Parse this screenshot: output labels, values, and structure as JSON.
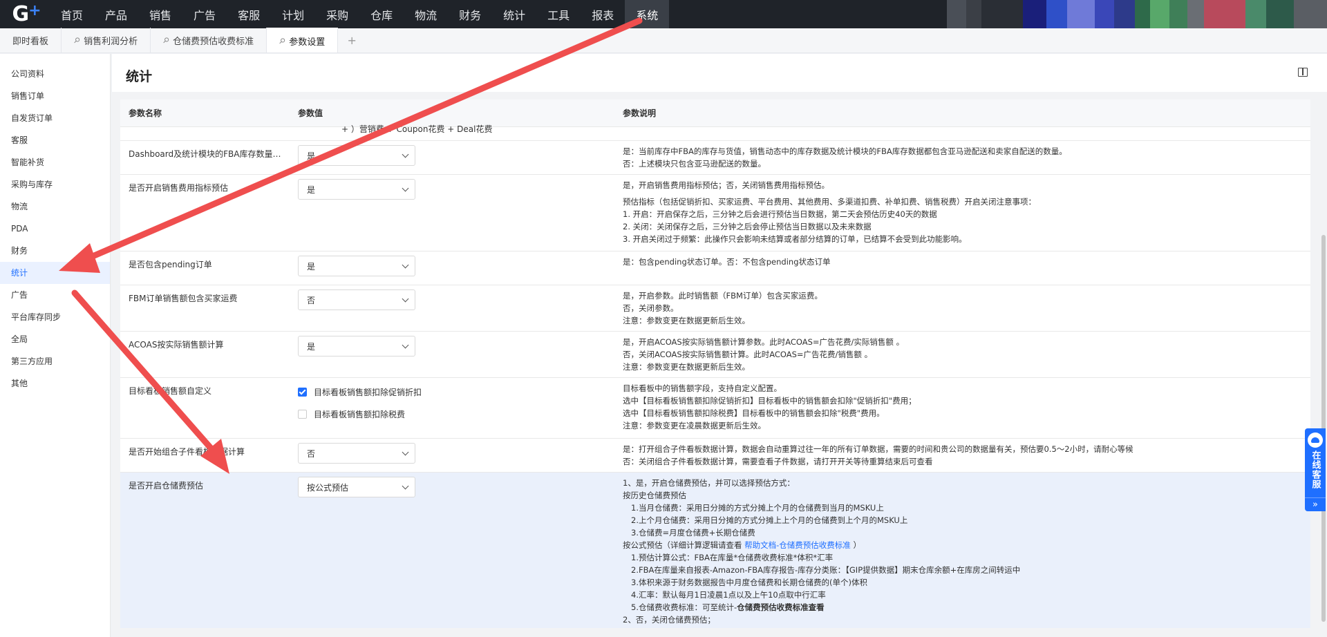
{
  "topnav": {
    "logo": "G",
    "items": [
      "首页",
      "产品",
      "销售",
      "广告",
      "客服",
      "计划",
      "采购",
      "仓库",
      "物流",
      "财务",
      "统计",
      "工具",
      "报表",
      "系统"
    ],
    "active": "系统",
    "blocks": [
      "#4a4f57",
      "#3b3f46",
      "#2a2e35",
      "#1a1f7a",
      "#2f50c8",
      "#6f7ad8",
      "#3a47b8",
      "#2d3a8a",
      "#2e6a4a",
      "#58a86a",
      "#3f7f58",
      "#6a6e74",
      "#b84a5c",
      "#4a8a6a",
      "#2d5a4a",
      "#5a5e64"
    ]
  },
  "tabs": [
    {
      "label": "即时看板",
      "pinned": false,
      "active": false
    },
    {
      "label": "销售利润分析",
      "pinned": true,
      "active": false
    },
    {
      "label": "仓储费预估收费标准",
      "pinned": true,
      "active": false
    },
    {
      "label": "参数设置",
      "pinned": true,
      "active": true
    }
  ],
  "tab_add": "+",
  "sidebar": {
    "items": [
      "公司资料",
      "销售订单",
      "自发货订单",
      "客服",
      "智能补货",
      "采购与库存",
      "物流",
      "PDA",
      "财务",
      "统计",
      "广告",
      "平台库存同步",
      "全局",
      "第三方应用",
      "其他"
    ],
    "active": "统计"
  },
  "page": {
    "title": "统计"
  },
  "table": {
    "headers": [
      "参数名称",
      "参数值",
      "参数说明"
    ],
    "partial_text": "+ ）营销费 + Coupon花费 + Deal花费",
    "rows": [
      {
        "name": "Dashboard及统计模块的FBA库存数量是...",
        "type": "select",
        "value": "是",
        "desc": [
          {
            "t": "是：当前库存中FBA的库存与货值，销售动态中的库存数据及统计模块的FBA库存数据都包含亚马逊配送和卖家自配送的数量。"
          },
          {
            "t": "否：上述模块只包含亚马逊配送的数量。"
          }
        ]
      },
      {
        "name": "是否开启销售费用指标预估",
        "type": "select",
        "value": "是",
        "desc": [
          {
            "t": "是，开启销售费用指标预估；否，关闭销售费用指标预估。"
          },
          {
            "t": "预估指标（包括促销折扣、买家运费、平台费用、其他费用、多渠道扣费、补单扣费、销售税费）开启关闭注意事项：",
            "gap": true
          },
          {
            "t": "1. 开启：开启保存之后，三分钟之后会进行预估当日数据，第二天会预估历史40天的数据"
          },
          {
            "t": "2. 关闭：关闭保存之后，三分钟之后会停止预估当日数据以及未来数据"
          },
          {
            "t": "3. 开启关闭过于频繁：此操作只会影响未结算或者部分结算的订单，已结算不会受到此功能影响。"
          }
        ]
      },
      {
        "name": "是否包含pending订单",
        "type": "select",
        "value": "是",
        "desc": [
          {
            "t": "是：包含pending状态订单。否：不包含pending状态订单"
          }
        ]
      },
      {
        "name": "FBM订单销售额包含买家运费",
        "type": "select",
        "value": "否",
        "desc": [
          {
            "t": "是，开启参数。此时销售额（FBM订单）包含买家运费。"
          },
          {
            "t": "否，关闭参数。"
          },
          {
            "t": "注意：参数变更在数据更新后生效。"
          }
        ]
      },
      {
        "name": "ACOAS按实际销售额计算",
        "type": "select",
        "value": "是",
        "desc": [
          {
            "t": "是，开启ACOAS按实际销售额计算参数。此时ACOAS=广告花费/实际销售额 。"
          },
          {
            "t": "否，关闭ACOAS按实际销售额计算。此时ACOAS=广告花费/销售额 。"
          },
          {
            "t": "注意：参数变更在数据更新后生效。"
          }
        ]
      },
      {
        "name": "目标看板销售额自定义",
        "type": "checkbox",
        "options": [
          {
            "label": "目标看板销售额扣除促销折扣",
            "checked": true
          },
          {
            "label": "目标看板销售额扣除税费",
            "checked": false
          }
        ],
        "desc": [
          {
            "t": "目标看板中的销售额字段，支持自定义配置。"
          },
          {
            "t": "选中【目标看板销售额扣除促销折扣】目标看板中的销售额会扣除\"促销折扣\"费用；"
          },
          {
            "t": "选中【目标看板销售额扣除税费】目标看板中的销售额会扣除\"税费\"费用。"
          },
          {
            "t": "注意：参数变更在凌晨数据更新后生效。"
          }
        ]
      },
      {
        "name": "是否开始组合子件看板数据计算",
        "type": "select",
        "value": "否",
        "desc": [
          {
            "t": "是：打开组合子件看板数据计算，数据会自动重算过往一年的所有订单数据，需要的时间和贵公司的数据量有关，预估要0.5～2小时，请耐心等候"
          },
          {
            "t": "否：关闭组合子件看板数据计算，需要查看子件数据，请打开开关等待重算结束后可查看"
          }
        ]
      },
      {
        "name": "是否开启仓储费预估",
        "type": "select",
        "value": "按公式预估",
        "highlight": true,
        "desc": [
          {
            "t": "1、是，开启仓储费预估，并可以选择预估方式："
          },
          {
            "t": "按历史仓储费预估"
          },
          {
            "t": "1.当月仓储费：采用日分摊的方式分摊上个月的仓储费到当月的MSKU上",
            "indent": true
          },
          {
            "t": "2.上个月仓储费：采用日分摊的方式分摊上上个月的仓储费到上个月的MSKU上",
            "indent": true
          },
          {
            "t": "3.仓储费=月度仓储费+长期仓储费",
            "indent": true
          },
          {
            "t": "按公式预估（详细计算逻辑请查看 ",
            "link": "帮助文档-仓储费预估收费标准",
            "after": " ）"
          },
          {
            "t": "1.预估计算公式：FBA在库量*仓储费收费标准*体积*汇率",
            "indent": true
          },
          {
            "t": "2.FBA在库量来自报表-Amazon-FBA库存报告-库存分类账：【GIP提供数据】期末仓库余额+在库房之间转运中",
            "indent": true
          },
          {
            "t": "3.体积来源于财务数据报告中月度仓储费和长期仓储费的(单个)体积",
            "indent": true
          },
          {
            "t": "4.汇率：默认每月1日凌晨1点以及上午10点取中行汇率",
            "indent": true
          },
          {
            "t": "5.仓储费收费标准：可至统计-",
            "bold": "仓储费预估收费标准查看",
            "indent": true
          },
          {
            "t": "2、否，关闭仓储费预估；"
          }
        ]
      }
    ]
  },
  "service": {
    "label": "在线客服",
    "arrow": "»"
  },
  "colors": {
    "accent": "#1f6fff",
    "arrow": "#ef4e4e",
    "nav_bg": "#1f2329"
  }
}
